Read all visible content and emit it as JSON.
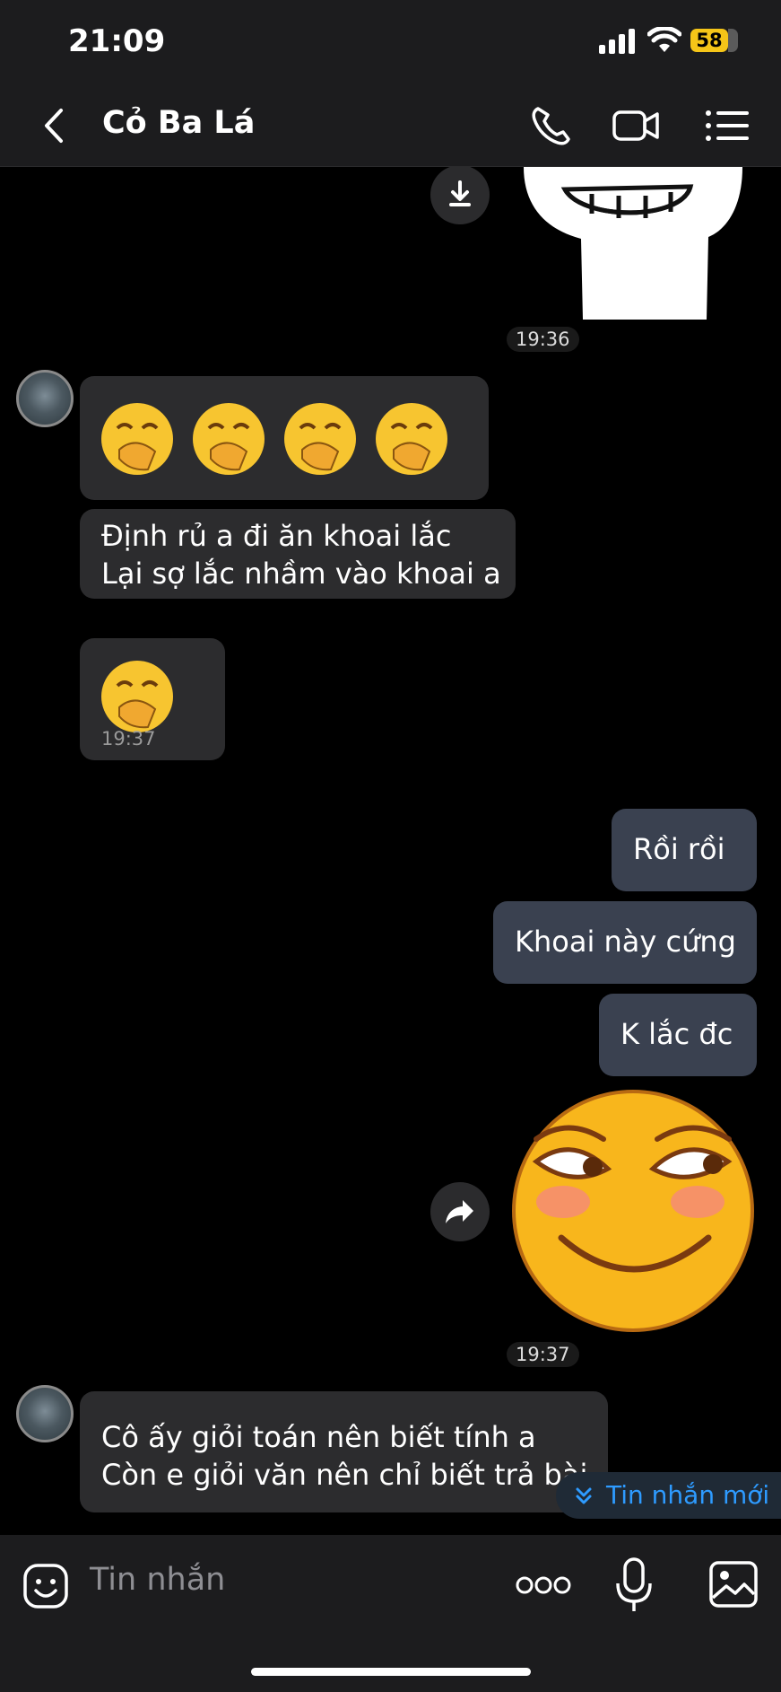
{
  "status_bar": {
    "time": "21:09",
    "battery": "58"
  },
  "header": {
    "title": "Cỏ Ba Lá"
  },
  "messages": {
    "ts1": "19:36",
    "text1": "Định rủ a  đi ăn khoai lắc\nLại sợ lắc nhầm vào khoai a",
    "ts2": "19:37",
    "out1": "Rồi rồi",
    "out2": "Khoai này cứng",
    "out3": "K lắc đc",
    "ts3": "19:37",
    "text2": "Cô ấy giỏi toán nên biết tính a\nCòn e giỏi văn nên chỉ biết trả bài"
  },
  "new_message_banner": "Tin nhắn mới",
  "composer": {
    "placeholder": "Tin nhắn"
  },
  "icons": [
    "back-icon",
    "phone-icon",
    "video-icon",
    "menu-icon",
    "download-icon",
    "forward-icon",
    "emoji-icon",
    "more-icon",
    "mic-icon",
    "image-icon"
  ]
}
